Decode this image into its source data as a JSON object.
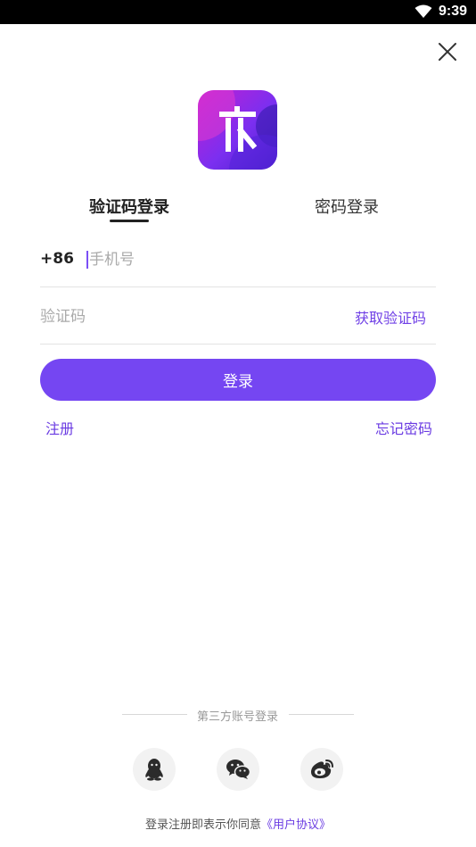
{
  "status_bar": {
    "time": "9:39",
    "wifi_icon": "wifi-icon"
  },
  "header": {
    "close_icon": "close-icon"
  },
  "logo": {
    "glyph": "木",
    "colors": [
      "#c11fd2",
      "#7b2ff0",
      "#4a21c9"
    ]
  },
  "tabs": [
    {
      "label": "验证码登录",
      "active": true
    },
    {
      "label": "密码登录",
      "active": false
    }
  ],
  "phone": {
    "country_code": "+86",
    "placeholder": "手机号",
    "value": ""
  },
  "code": {
    "placeholder": "验证码",
    "value": "",
    "get_code_label": "获取验证码"
  },
  "login_button": "登录",
  "links": {
    "register": "注册",
    "forgot_password": "忘记密码"
  },
  "third_party": {
    "label": "第三方账号登录",
    "providers": [
      {
        "icon": "qq-icon"
      },
      {
        "icon": "wechat-icon"
      },
      {
        "icon": "weibo-icon"
      }
    ]
  },
  "agreement": {
    "prefix": "登录注册即表示你同意",
    "link": "《用户协议》"
  },
  "colors": {
    "accent": "#7546f2",
    "link": "#6a3be2"
  }
}
